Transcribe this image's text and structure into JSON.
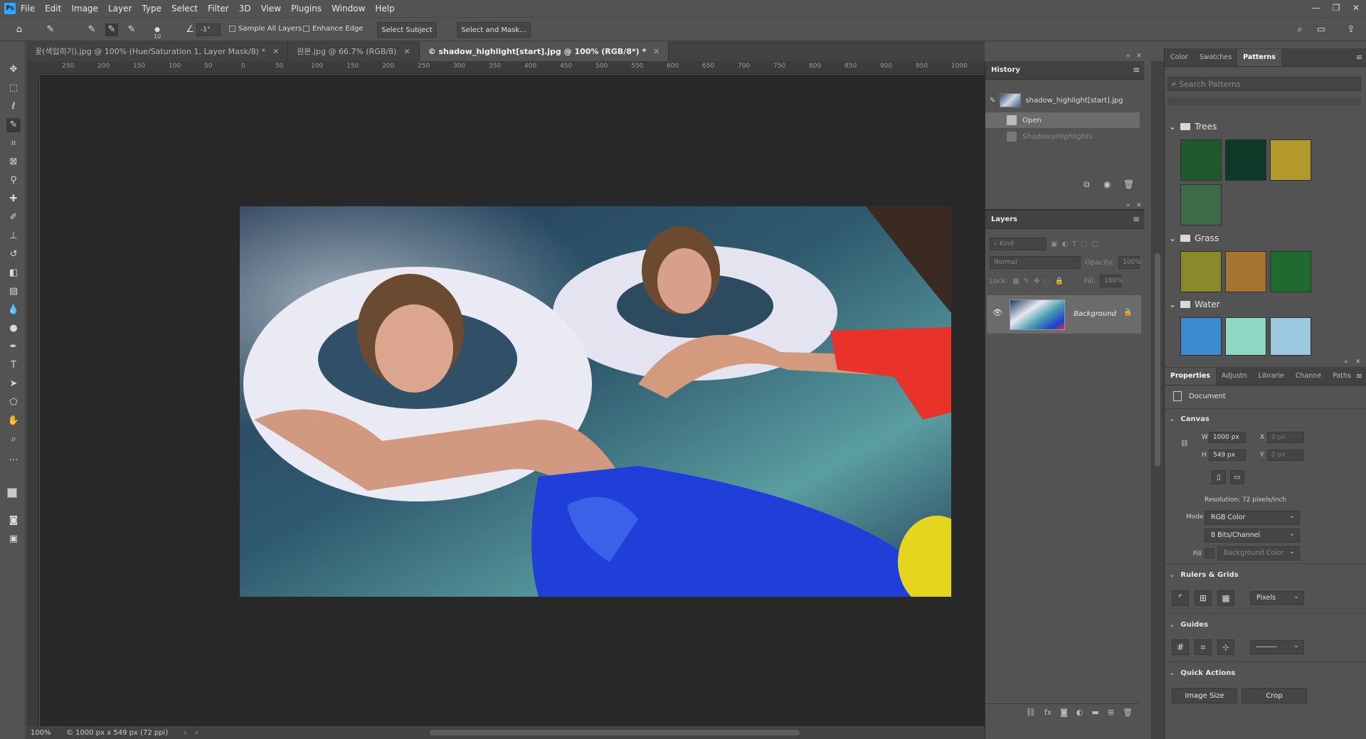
{
  "menu": [
    "File",
    "Edit",
    "Image",
    "Layer",
    "Type",
    "Select",
    "Filter",
    "3D",
    "View",
    "Plugins",
    "Window",
    "Help"
  ],
  "options": {
    "brush_size": "10",
    "angle": "-1°",
    "sample_all_layers": "Sample All Layers",
    "enhance_edge": "Enhance Edge",
    "select_subject": "Select Subject",
    "select_and_mask": "Select and Mask..."
  },
  "tabs": [
    {
      "label": "꽃(색입히기).jpg @ 100% (Hue/Saturation 1, Layer Mask/8) *"
    },
    {
      "label": "원본.jpg @ 66.7% (RGB/8)"
    },
    {
      "label": "© shadow_highlight[start].jpg @ 100% (RGB/8*) *"
    }
  ],
  "ruler_ticks": [
    "250",
    "200",
    "150",
    "100",
    "50",
    "0",
    "50",
    "100",
    "150",
    "200",
    "250",
    "300",
    "350",
    "400",
    "450",
    "500",
    "550",
    "600",
    "650",
    "700",
    "750",
    "800",
    "850",
    "900",
    "950",
    "1000"
  ],
  "status": {
    "zoom": "100%",
    "doc_info": "© 1000 px x 549 px (72 ppi)"
  },
  "history": {
    "title": "History",
    "snapshot": "shadow_highlight[start].jpg",
    "items": [
      {
        "label": "Open"
      },
      {
        "label": "Shadows/Highlights"
      }
    ]
  },
  "layers": {
    "title": "Layers",
    "kind_placeholder": "Kind",
    "blend": "Normal",
    "opacity_label": "Opacity:",
    "opacity": "100%",
    "lock_label": "Lock:",
    "fill_label": "Fill:",
    "fill": "100%",
    "layer_name": "Background"
  },
  "patterns": {
    "tabs": [
      "Color",
      "Swatches",
      "Patterns"
    ],
    "search_placeholder": "Search Patterns",
    "groups": [
      {
        "name": "Trees",
        "colors": [
          "#1f5a2e",
          "#0f3a2a",
          "#b39a2a",
          "#3f6a4a"
        ]
      },
      {
        "name": "Grass",
        "colors": [
          "#8a8a2a",
          "#a5742e",
          "#1f6a2e"
        ]
      },
      {
        "name": "Water",
        "colors": [
          "#3c8ad0",
          "#8fd6c4",
          "#9cc8e0"
        ]
      }
    ]
  },
  "properties": {
    "tabs": [
      "Properties",
      "Adjustn",
      "Librarie",
      "Channe",
      "Paths"
    ],
    "document_label": "Document",
    "canvas_title": "Canvas",
    "w_label": "W",
    "w_value": "1000 px",
    "h_label": "H",
    "h_value": "549 px",
    "x_label": "X",
    "x_value": "0 px",
    "y_label": "Y",
    "y_value": "0 px",
    "resolution": "Resolution: 72 pixels/inch",
    "mode_label": "Mode",
    "mode_value": "RGB Color",
    "bits_value": "8 Bits/Channel",
    "fill_label": "Fill",
    "fill_value": "Background Color",
    "rulers_title": "Rulers & Grids",
    "units_value": "Pixels",
    "guides_title": "Guides",
    "quick_actions_title": "Quick Actions",
    "image_size_btn": "Image Size",
    "crop_btn": "Crop"
  }
}
